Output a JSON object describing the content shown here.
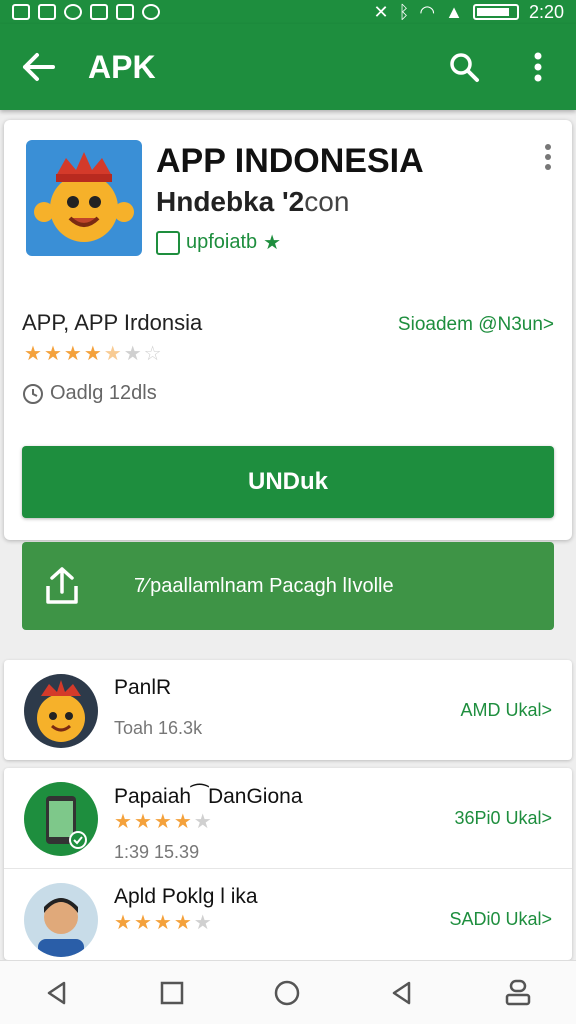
{
  "status_bar": {
    "time": "2:20"
  },
  "app_bar": {
    "title": "APK"
  },
  "app": {
    "title_line1": "APP  INDONESIA",
    "title_line2_bold": "Hndebka '2",
    "title_line2_thin": "con",
    "badge": "upfoiatb",
    "developer": "APP, APP Irdonsia",
    "developer_link": "Sioadem @N3un>",
    "rating": 4.5,
    "downloads": "Oadlg 12dls",
    "install_label": "UNDuk"
  },
  "share": {
    "text": "7⁄ paallamlnam Pacagh lIvolle"
  },
  "list": [
    {
      "title": "PanlR",
      "sub": "Toah 16.3k",
      "link": "AMD Ukal>",
      "rating": null
    },
    {
      "title": "Papaiah⁀DanGiona",
      "sub": "1:39 15.39",
      "link": "36Pi0 Ukal>",
      "rating": 4
    },
    {
      "title": "Apld Poklg l ika",
      "sub": "",
      "link": "SADi0 Ukal>",
      "rating": 4
    }
  ],
  "colors": {
    "primary": "#1e8e3e",
    "star": "#f4a13b",
    "share": "#3e9446"
  },
  "icons": [
    "back-arrow-icon",
    "search-icon",
    "more-vert-icon",
    "share-icon",
    "clock-icon",
    "editor-badge-icon"
  ]
}
